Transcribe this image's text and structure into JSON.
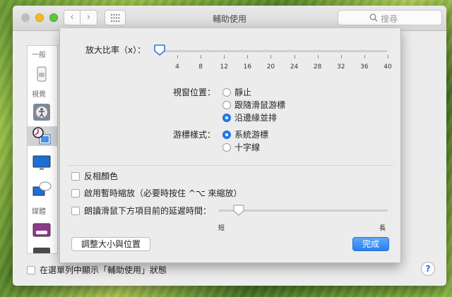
{
  "window": {
    "title": "輔助使用",
    "search_placeholder": "搜尋"
  },
  "sidebar": {
    "headers": [
      "一般",
      "視覺",
      "媒體"
    ],
    "items": [
      {
        "icon": "switch-icon"
      },
      {
        "icon": "voiceover-icon"
      },
      {
        "icon": "zoom-icon",
        "selected": true
      },
      {
        "icon": "display-icon"
      },
      {
        "icon": "descriptions-icon"
      },
      {
        "icon": "captions-icon"
      },
      {
        "icon": "media-icon"
      }
    ]
  },
  "footer": {
    "show_in_menubar_label": "在選單列中顯示「輔助使用」狀態",
    "show_in_menubar_checked": false,
    "help_label": "?"
  },
  "sheet": {
    "zoom_label": "放大比率（x）：",
    "zoom_ticks": [
      "4",
      "8",
      "12",
      "16",
      "20",
      "24",
      "28",
      "32",
      "36",
      "40"
    ],
    "zoom_value": 1,
    "view_position_label": "視窗位置：",
    "view_position_options": [
      {
        "label": "靜止",
        "selected": false
      },
      {
        "label": "跟隨滑鼠游標",
        "selected": false
      },
      {
        "label": "沿邊緣並排",
        "selected": true
      }
    ],
    "cursor_style_label": "游標樣式：",
    "cursor_style_options": [
      {
        "label": "系統游標",
        "selected": true
      },
      {
        "label": "十字線",
        "selected": false
      }
    ],
    "invert_colors_label": "反相顏色",
    "temp_zoom_label": "啟用暫時縮放（必要時按住 ^⌥ 來縮放）",
    "speak_delay_label": "朗讀滑鼠下方項目前的延遲時間：",
    "delay_short_label": "短",
    "delay_long_label": "長",
    "delay_fraction": 0.12,
    "resize_button_label": "調整大小與位置",
    "done_button_label": "完成"
  },
  "colors": {
    "accent": "#1f7df5"
  }
}
